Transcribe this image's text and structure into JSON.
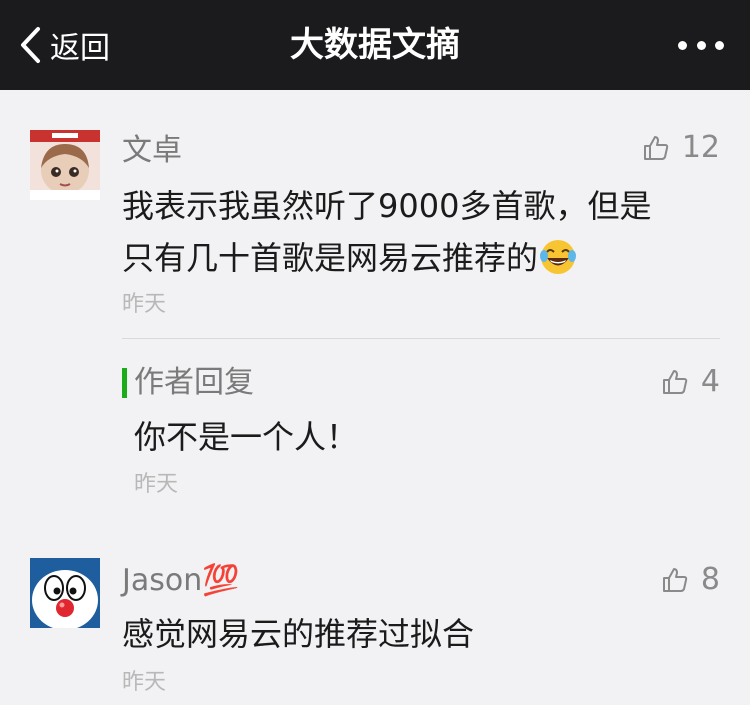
{
  "nav": {
    "back_label": "返回",
    "title": "大数据文摘"
  },
  "comments": [
    {
      "name": "文卓",
      "likes": "12",
      "text_line1": "我表示我虽然听了9000多首歌，但是",
      "text_line2": "只有几十首歌是网易云推荐的",
      "time": "昨天",
      "reply": {
        "label": "作者回复",
        "likes": "4",
        "text": "你不是一个人！",
        "time": "昨天"
      }
    },
    {
      "name": "Jason💯",
      "likes": "8",
      "text": "感觉网易云的推荐过拟合",
      "time": "昨天"
    }
  ],
  "colors": {
    "header_bg": "#1b1b1d",
    "page_bg": "#f2f2f4",
    "reply_accent": "#1aad19"
  }
}
